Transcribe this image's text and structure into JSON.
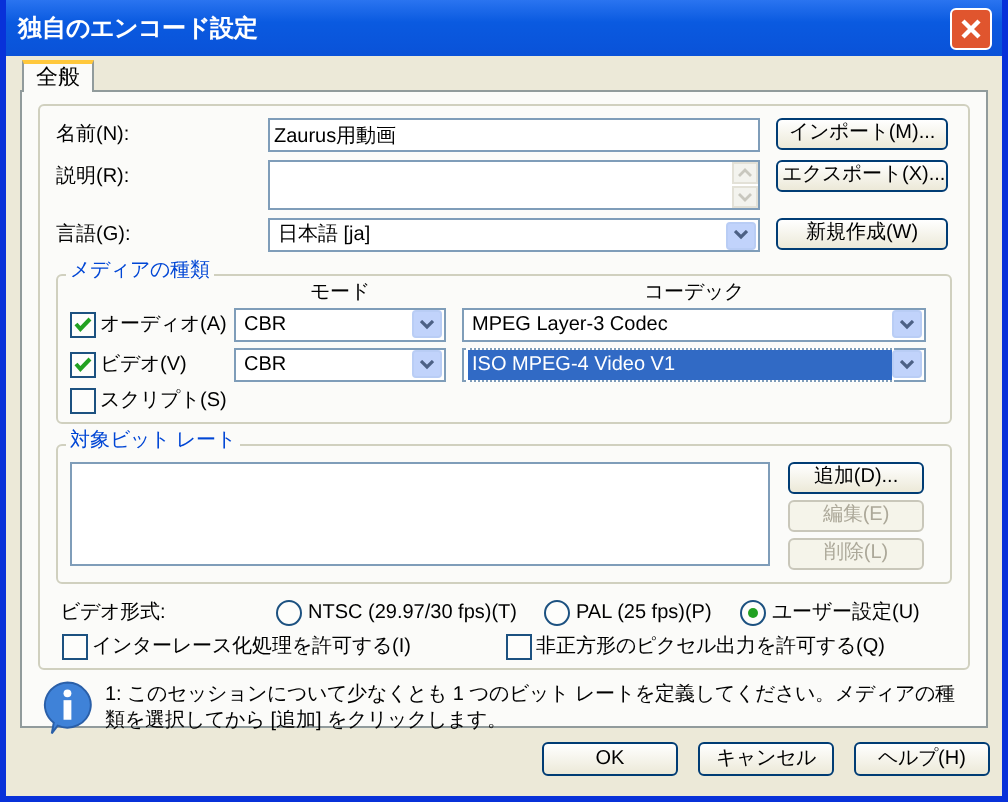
{
  "window": {
    "title": "独自のエンコード設定"
  },
  "tabs": [
    {
      "label": "全般",
      "selected": true
    }
  ],
  "fields": [
    {
      "kind": "text",
      "label": "名前(N):",
      "value": "Zaurus用動画"
    },
    {
      "kind": "multiline",
      "label": "説明(R):"
    },
    {
      "kind": "dropdown",
      "label": "言語(G):",
      "value": "日本語 [ja]"
    }
  ],
  "side_buttons": [
    "インポート(M)...",
    "エクスポート(X)...",
    "新規作成(W)"
  ],
  "media_types": {
    "title": "メディアの種類",
    "columns": [
      "モード",
      "コーデック"
    ],
    "rows": [
      {
        "kind": "stream",
        "label": "オーディオ(A)",
        "checked": true,
        "mode": "CBR",
        "codec": "MPEG Layer-3 Codec",
        "focused": false
      },
      {
        "kind": "stream",
        "label": "ビデオ(V)",
        "checked": true,
        "mode": "CBR",
        "codec": "ISO MPEG-4 Video V1",
        "focused": true
      },
      {
        "kind": "plain",
        "label": "スクリプト(S)",
        "checked": false
      }
    ]
  },
  "bitrate": {
    "title": "対象ビット レート",
    "buttons": [
      {
        "label": "追加(D)...",
        "disabled": false
      },
      {
        "label": "編集(E)",
        "disabled": true
      },
      {
        "label": "削除(L)",
        "disabled": true
      }
    ]
  },
  "video_format": {
    "label": "ビデオ形式:",
    "options": [
      {
        "label": "NTSC (29.97/30 fps)(T)",
        "selected": false
      },
      {
        "label": "PAL (25 fps)(P)",
        "selected": false
      },
      {
        "label": "ユーザー設定(U)",
        "selected": true
      }
    ]
  },
  "options": [
    {
      "label": "インターレース化処理を許可する(I)",
      "checked": false
    },
    {
      "label": "非正方形のピクセル出力を許可する(Q)",
      "checked": false
    }
  ],
  "info": {
    "text": "1: このセッションについて少なくとも 1 つのビット レートを定義してください。メディアの種類を選択してから [追加] をクリックします。"
  },
  "dialog_buttons": [
    "OK",
    "キャンセル",
    "ヘルプ(H)"
  ]
}
